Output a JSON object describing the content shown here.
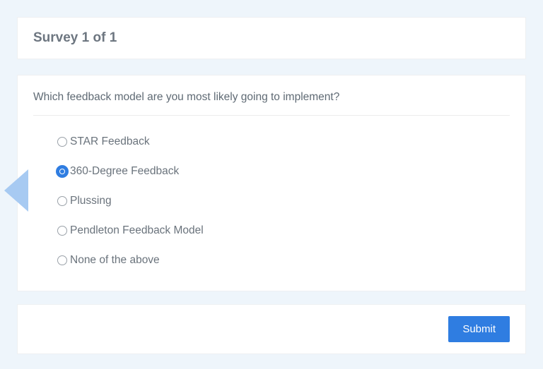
{
  "header": {
    "title": "Survey 1 of 1"
  },
  "question": {
    "text": "Which feedback model are you most likely going to implement?",
    "selected_index": 1,
    "options": [
      {
        "label": "STAR Feedback"
      },
      {
        "label": "360-Degree Feedback"
      },
      {
        "label": "Plussing"
      },
      {
        "label": "Pendleton Feedback Model"
      },
      {
        "label": "None of the above"
      }
    ]
  },
  "footer": {
    "submit_label": "Submit"
  },
  "colors": {
    "accent": "#2f7de1",
    "page_bg": "#eef5fb",
    "text_muted": "#6d7680"
  }
}
